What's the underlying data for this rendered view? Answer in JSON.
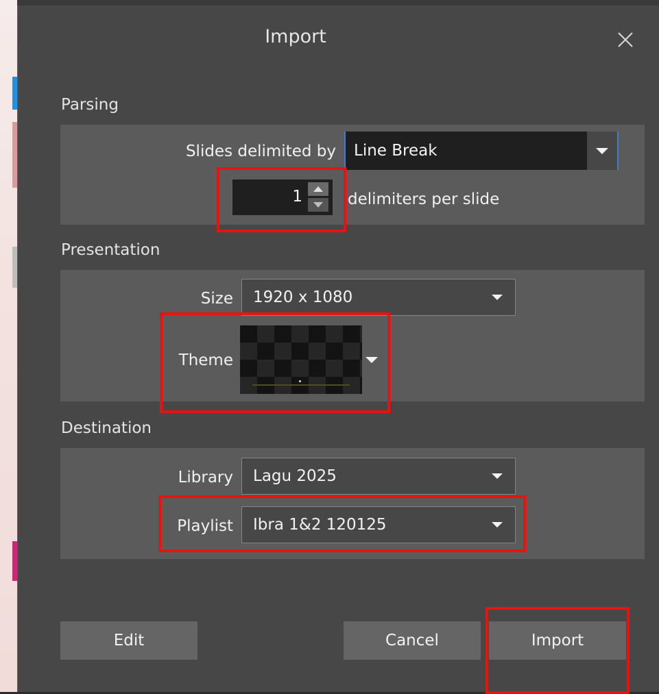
{
  "dialog": {
    "title": "Import",
    "close_symbol": "✕"
  },
  "parsing": {
    "section_label": "Parsing",
    "delimiter_label": "Slides delimited by",
    "delimiter_value": "Line Break",
    "count_value": "1",
    "count_label": "delimiters per slide"
  },
  "presentation": {
    "section_label": "Presentation",
    "size_label": "Size",
    "size_value": "1920 x 1080",
    "theme_label": "Theme"
  },
  "destination": {
    "section_label": "Destination",
    "library_label": "Library",
    "library_value": "Lagu 2025",
    "playlist_label": "Playlist",
    "playlist_value": "Ibra 1&2 120125"
  },
  "buttons": {
    "edit": "Edit",
    "cancel": "Cancel",
    "import": "Import"
  },
  "colors": {
    "dialog_bg": "#474747",
    "panel_bg": "#5b5b5b",
    "highlight": "#ea1111",
    "focus_accent": "#3f7fcf"
  }
}
